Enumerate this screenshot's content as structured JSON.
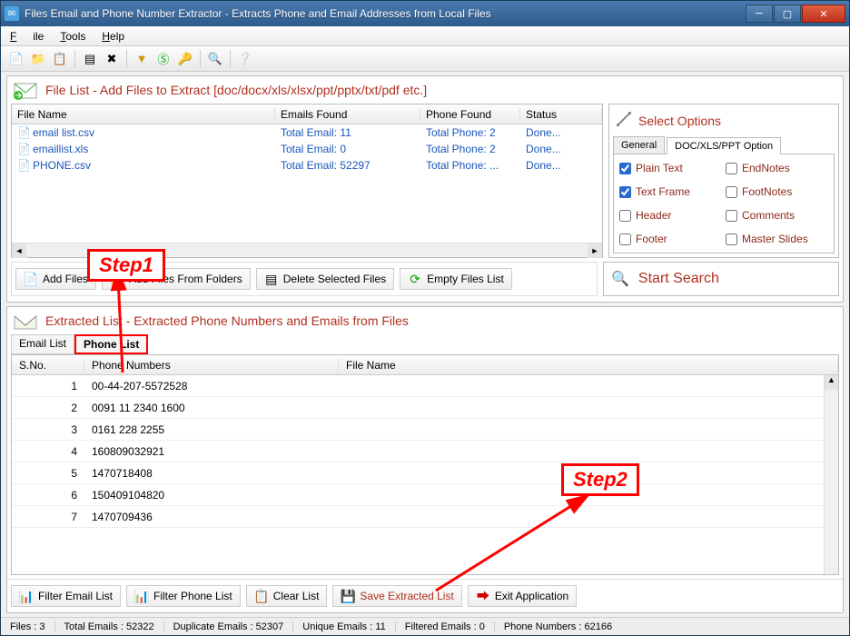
{
  "title": "Files Email and Phone Number Extractor  -   Extracts Phone and Email Addresses from Local Files",
  "menu": {
    "file": "File",
    "tools": "Tools",
    "help": "Help"
  },
  "panel1": {
    "title": "File List - Add Files to Extract  [doc/docx/xls/xlsx/ppt/pptx/txt/pdf etc.]"
  },
  "filecols": {
    "name": "File Name",
    "emails": "Emails Found",
    "phone": "Phone Found",
    "status": "Status"
  },
  "files": [
    {
      "name": "email list.csv",
      "emails": "Total Email: 11",
      "phone": "Total Phone: 2",
      "status": "Done..."
    },
    {
      "name": "emaillist.xls",
      "emails": "Total Email: 0",
      "phone": "Total Phone: 2",
      "status": "Done..."
    },
    {
      "name": "PHONE.csv",
      "emails": "Total Email: 52297",
      "phone": "Total Phone: ...",
      "status": "Done..."
    }
  ],
  "options": {
    "heading": "Select Options",
    "tab_general": "General",
    "tab_doc": "DOC/XLS/PPT Option",
    "plain": "Plain Text",
    "frame": "Text Frame",
    "header": "Header",
    "footer": "Footer",
    "endnotes": "EndNotes",
    "footnotes": "FootNotes",
    "comments": "Comments",
    "master": "Master Slides"
  },
  "filebtns": {
    "add": "Add Files",
    "addfolder": "Add Files From Folders",
    "delete": "Delete Selected Files",
    "empty": "Empty Files List"
  },
  "search": "Start Search",
  "panel2": {
    "title": "Extracted List - Extracted Phone Numbers and Emails from Files"
  },
  "etabs": {
    "email": "Email List",
    "phone": "Phone List"
  },
  "dgcols": {
    "sno": "S.No.",
    "pnum": "Phone Numbers",
    "fname": "File Name"
  },
  "rows": [
    {
      "n": "1",
      "p": "00-44-207-5572528"
    },
    {
      "n": "2",
      "p": "0091 11 2340 1600"
    },
    {
      "n": "3",
      "p": "0161 228 2255"
    },
    {
      "n": "4",
      "p": "160809032921"
    },
    {
      "n": "5",
      "p": "1470718408"
    },
    {
      "n": "6",
      "p": "150409104820"
    },
    {
      "n": "7",
      "p": "1470709436"
    }
  ],
  "btmbtns": {
    "femail": "Filter Email List",
    "fphone": "Filter Phone List",
    "clear": "Clear List",
    "save": "Save Extracted List",
    "exit": "Exit Application"
  },
  "status": {
    "files": "Files :  3",
    "total": "Total Emails :  52322",
    "dup": "Duplicate Emails :  52307",
    "uniq": "Unique Emails :  11",
    "filt": "Filtered Emails :  0",
    "phone": "Phone Numbers :  62166"
  },
  "annot": {
    "s1": "Step1",
    "s2": "Step2"
  }
}
